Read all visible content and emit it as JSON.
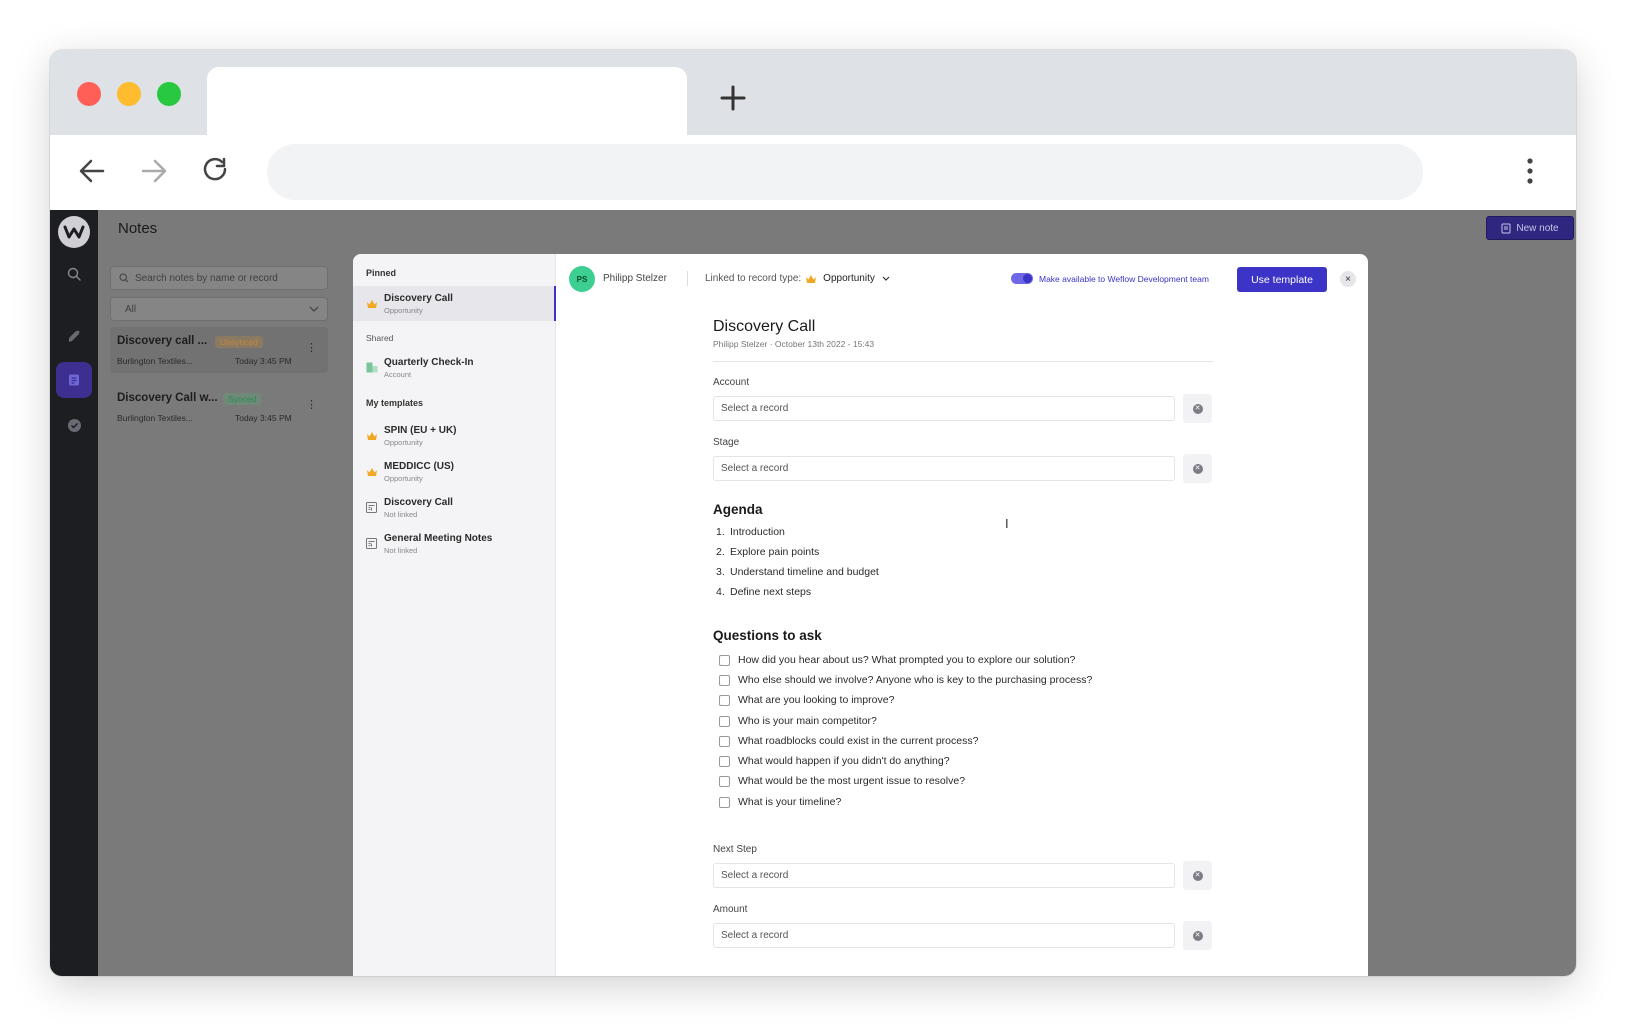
{
  "browser": {
    "newtab_icon": "plus-icon",
    "back_icon": "arrow-left-icon",
    "forward_icon": "arrow-right-icon",
    "reload_icon": "reload-icon",
    "menu_icon": "kebab-menu-icon"
  },
  "app": {
    "page_title": "Notes",
    "new_note_label": "New note",
    "search_placeholder": "Search notes by name or record",
    "filter_value": "All",
    "notes": [
      {
        "title": "Discovery call ...",
        "badge": "Unsynced",
        "badge_color": "#d8984a",
        "record": "Burlington Textiles...",
        "time": "Today 3:45 PM"
      },
      {
        "title": "Discovery Call w...",
        "badge": "Synced",
        "badge_color": "#3aa66d",
        "record": "Burlington Textiles...",
        "time": "Today 3:45 PM"
      }
    ]
  },
  "modal": {
    "sections": {
      "pinned": "Pinned",
      "shared": "Shared",
      "mine": "My templates"
    },
    "pinned": [
      {
        "name": "Discovery Call",
        "type": "Opportunity",
        "icon": "crown-icon"
      }
    ],
    "shared": [
      {
        "name": "Quarterly Check-In",
        "type": "Account",
        "icon": "building-icon"
      }
    ],
    "mine": [
      {
        "name": "SPIN (EU + UK)",
        "type": "Opportunity",
        "icon": "crown-icon"
      },
      {
        "name": "MEDDICC (US)",
        "type": "Opportunity",
        "icon": "crown-icon"
      },
      {
        "name": "Discovery Call",
        "type": "Not linked",
        "icon": "template-icon"
      },
      {
        "name": "General Meeting Notes",
        "type": "Not linked",
        "icon": "template-icon"
      }
    ],
    "header": {
      "avatar_initials": "PS",
      "author": "Philipp Stelzer",
      "linked_label": "Linked to record type:",
      "linked_type": "Opportunity",
      "toggle_on": true,
      "availability": "Make available to Weflow Development team",
      "use_template": "Use template",
      "close": "×"
    },
    "doc": {
      "title": "Discovery Call",
      "meta": "Philipp Stelzer · October 13th 2022 - 15:43",
      "fields": [
        {
          "label": "Account",
          "placeholder": "Select a record"
        },
        {
          "label": "Stage",
          "placeholder": "Select a record"
        },
        {
          "label": "Next Step",
          "placeholder": "Select a record"
        },
        {
          "label": "Amount",
          "placeholder": "Select a record"
        }
      ],
      "agenda_heading": "Agenda",
      "agenda": [
        "Introduction",
        "Explore pain points",
        "Understand timeline and budget",
        "Define next steps"
      ],
      "agenda_numbers": [
        "1.",
        "2.",
        "3.",
        "4."
      ],
      "questions_heading": "Questions to ask",
      "questions": [
        "How did you hear about us? What prompted you to explore our solution?",
        "Who else should we involve? Anyone who is key to the purchasing process?",
        "What are you looking to improve?",
        "Who is your main competitor?",
        "What roadblocks could exist in the current process?",
        "What would happen if you didn't do anything?",
        "What would be the most urgent issue to resolve?",
        "What is your timeline?"
      ]
    }
  }
}
